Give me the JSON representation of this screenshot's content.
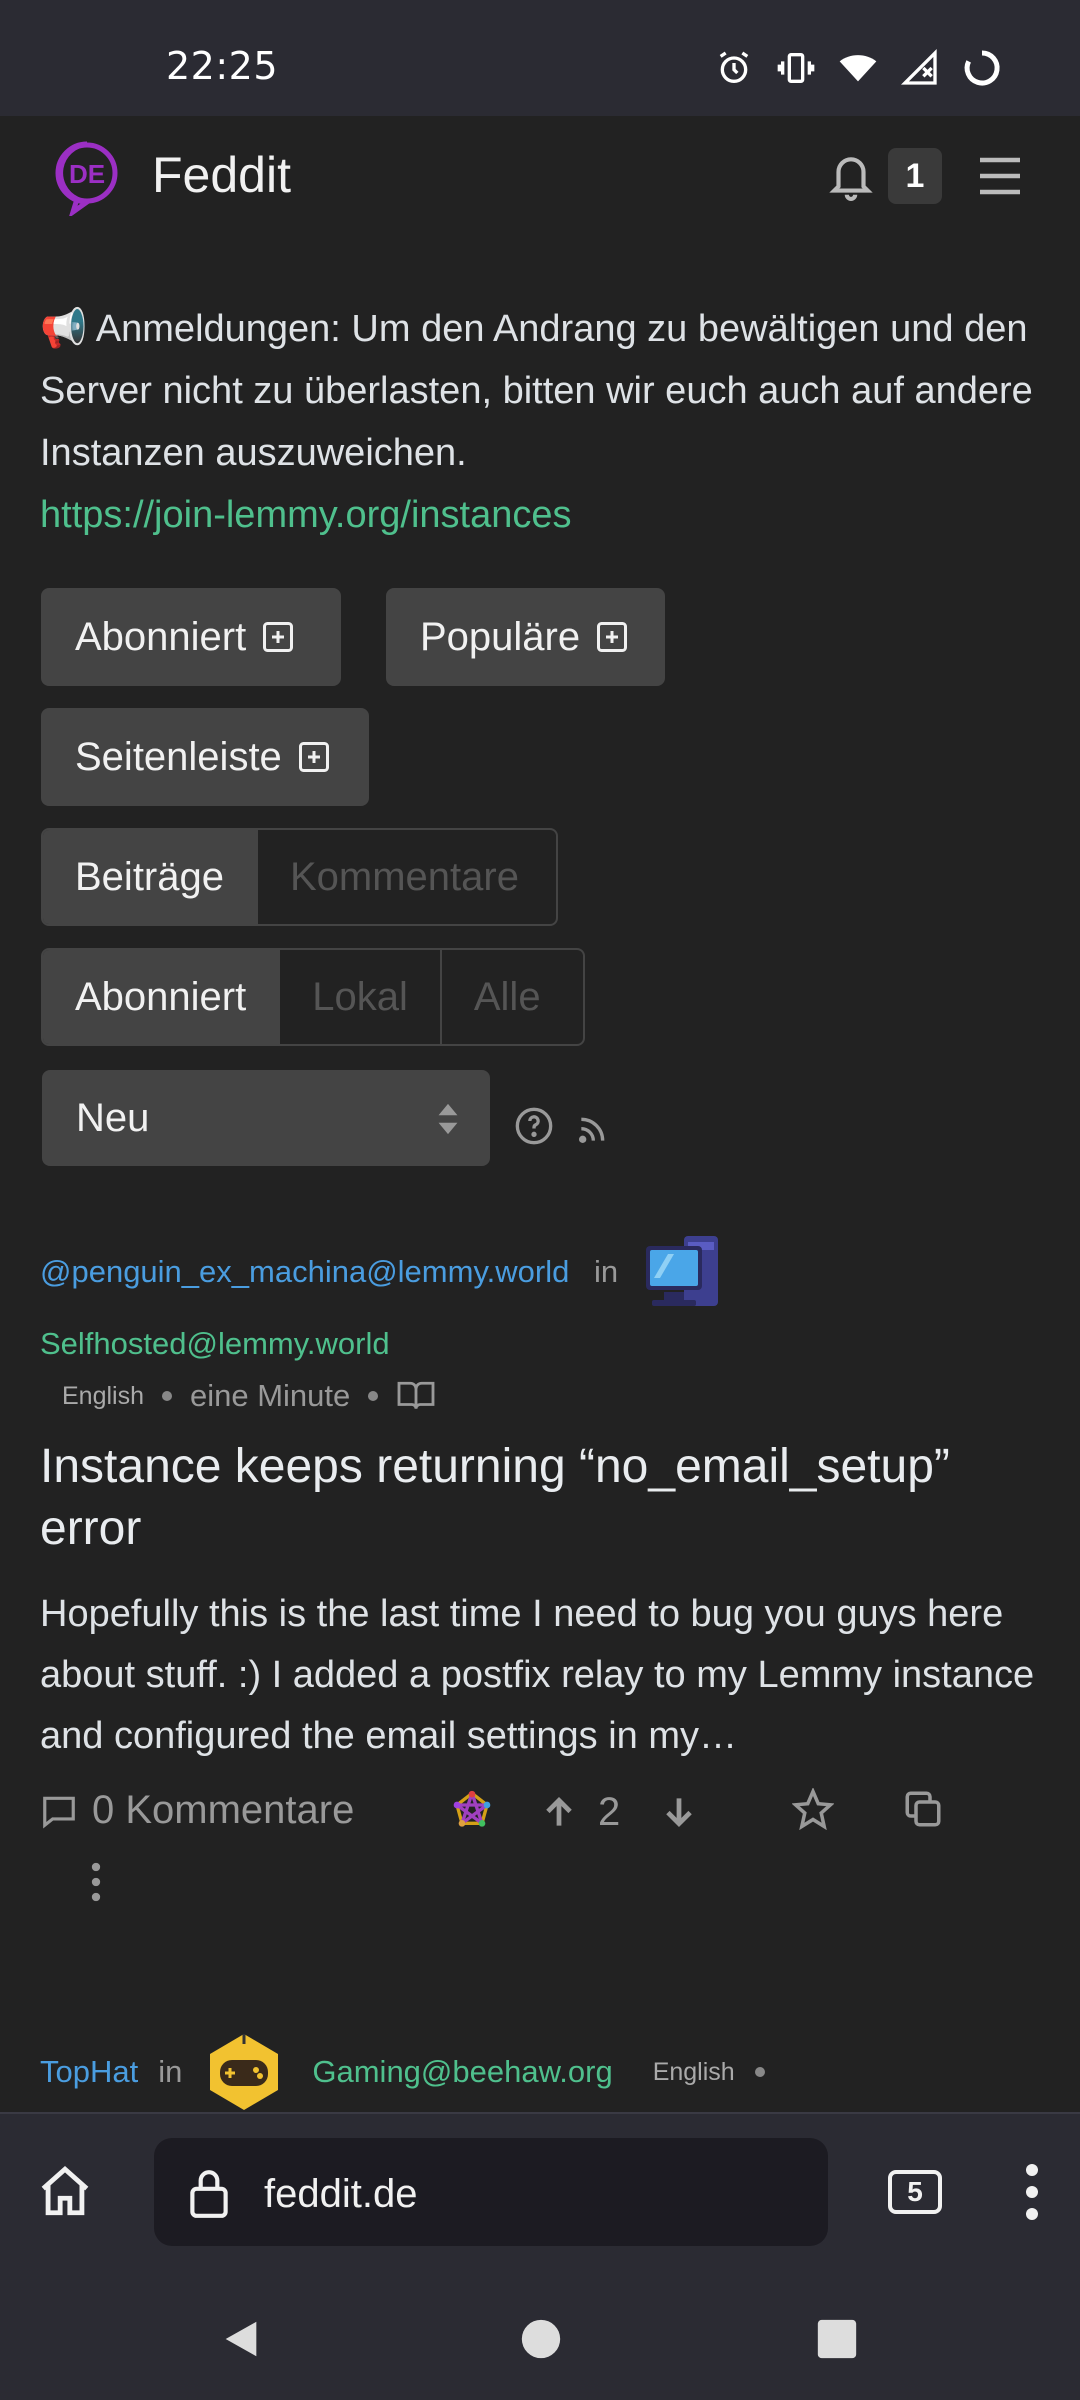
{
  "status_bar": {
    "time": "22:25",
    "icons": [
      "alarm-icon",
      "vibrate-icon",
      "wifi-icon",
      "signal-icon",
      "loading-icon"
    ]
  },
  "navbar": {
    "logo_text": "DE",
    "site_name": "Feddit",
    "notification_count": "1"
  },
  "announcement": {
    "emoji": "📢",
    "text": "Anmeldungen: Um den Andrang zu bewältigen und den Server nicht zu überlasten, bitten wir euch auch auf andere Instanzen auszuweichen.",
    "link": "https://join-lemmy.org/instances"
  },
  "sidebar_buttons": {
    "subscribed": "Abonniert",
    "popular": "Populäre",
    "sidebar": "Seitenleiste"
  },
  "view_toggle": {
    "posts": "Beiträge",
    "comments": "Kommentare"
  },
  "listing_toggle": {
    "subscribed": "Abonniert",
    "local": "Lokal",
    "all": "Alle"
  },
  "sort": {
    "selected": "Neu"
  },
  "post1": {
    "author": "@penguin_ex_machina@lemmy.world",
    "in_label": "in",
    "community": "Selfhosted@lemmy.world",
    "language": "English",
    "time": "eine Minute",
    "title": "Instance keeps returning “no_email_setup” error",
    "body": "Hopefully this is the last time I need to bug you guys here about stuff. :) I added a postfix relay to my Lemmy instance and configured the email settings in my…",
    "comments": "0 Kommentare",
    "score": "2"
  },
  "post2": {
    "author": "TopHat",
    "in_label": "in",
    "community": "Gaming@beehaw.org",
    "language": "English"
  },
  "browser": {
    "url": "feddit.de",
    "tab_count": "5"
  },
  "colors": {
    "background": "#222222",
    "link_green": "#4fc08d",
    "link_blue": "#4a9de0",
    "button_bg": "#444444",
    "logo_purple": "#9b2fc4"
  }
}
